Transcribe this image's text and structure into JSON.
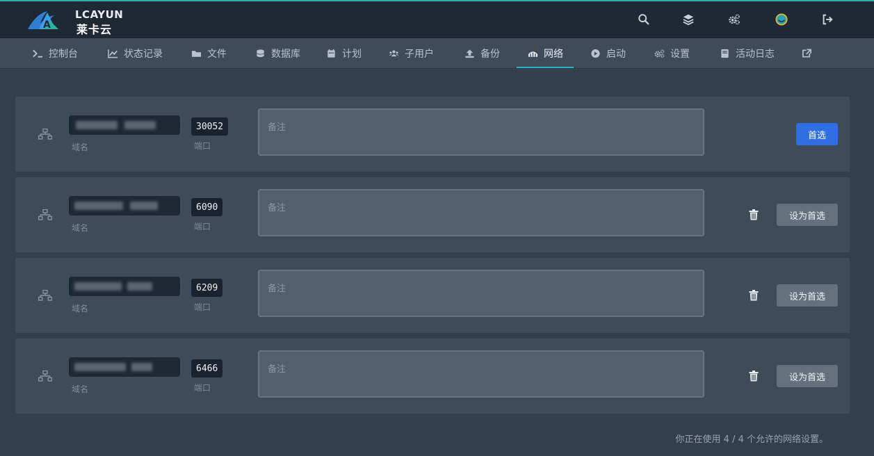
{
  "brand": {
    "en": "LCAYUN",
    "cn": "莱卡云"
  },
  "topbar": {
    "icons": [
      "search-icon",
      "layers-icon",
      "cogs-icon",
      "avatar",
      "logout-icon"
    ]
  },
  "nav": {
    "items": [
      {
        "label": "控制台",
        "icon": "terminal-icon"
      },
      {
        "label": "状态记录",
        "icon": "chart-line-icon"
      },
      {
        "label": "文件",
        "icon": "folder-icon"
      },
      {
        "label": "数据库",
        "icon": "database-icon"
      },
      {
        "label": "计划",
        "icon": "calendar-icon"
      },
      {
        "label": "子用户",
        "icon": "users-icon"
      },
      {
        "label": "备份",
        "icon": "upload-icon"
      },
      {
        "label": "网络",
        "icon": "network-wired-icon"
      },
      {
        "label": "启动",
        "icon": "play-circle-icon"
      },
      {
        "label": "设置",
        "icon": "cogs-icon"
      },
      {
        "label": "活动日志",
        "icon": "book-icon"
      }
    ],
    "active": "网络",
    "external_icon": "external-link-icon"
  },
  "allocations": [
    {
      "port": "30052",
      "domain_label": "域名",
      "port_label": "端口",
      "notes_placeholder": "备注",
      "action": "首选",
      "is_primary": true
    },
    {
      "port": "6090",
      "domain_label": "域名",
      "port_label": "端口",
      "notes_placeholder": "备注",
      "action": "设为首选",
      "is_primary": false
    },
    {
      "port": "6209",
      "domain_label": "域名",
      "port_label": "端口",
      "notes_placeholder": "备注",
      "action": "设为首选",
      "is_primary": false
    },
    {
      "port": "6466",
      "domain_label": "域名",
      "port_label": "端口",
      "notes_placeholder": "备注",
      "action": "设为首选",
      "is_primary": false
    }
  ],
  "footer": {
    "usage_text": "你正在使用 4 / 4 个允许的网络设置。"
  },
  "colors": {
    "accent": "#2bb3a8",
    "primary_button": "#2f6ee3",
    "active_tab_underline": "#27b3c7"
  }
}
